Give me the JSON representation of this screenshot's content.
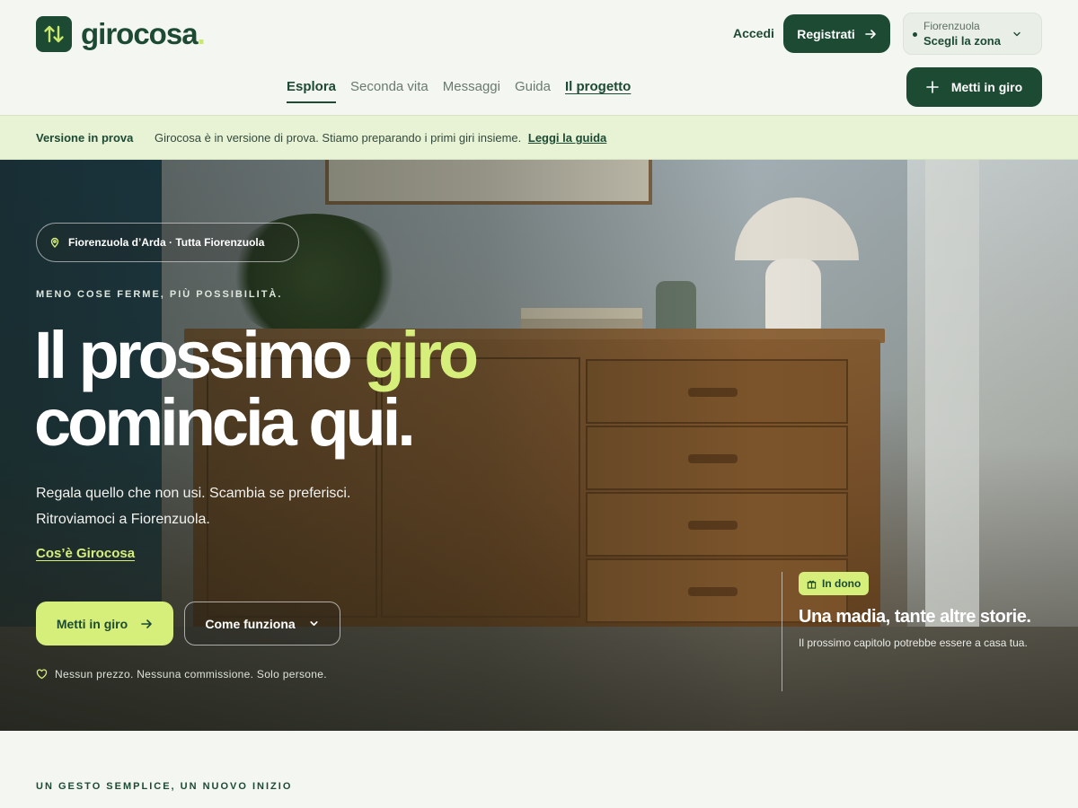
{
  "brand": {
    "name": "girocosa",
    "dot": "."
  },
  "header": {
    "login": "Accedi",
    "register": "Registrati",
    "zone_city": "Fiorenzuola",
    "zone_label": "Scegli la zona",
    "nav": [
      "Esplora",
      "Seconda vita",
      "Messaggi",
      "Guida",
      "Il progetto"
    ],
    "cta": "Metti in giro"
  },
  "banner": {
    "tag": "Versione in prova",
    "message": "Girocosa è in versione di prova. Stiamo preparando i primi giri insieme.",
    "link": "Leggi la guida"
  },
  "hero": {
    "location": "Fiorenzuola d’Arda · Tutta Fiorenzuola",
    "eyebrow": "MENO COSE FERME, PIÙ POSSIBILITÀ.",
    "title_a": "Il prossimo ",
    "title_hl": "giro",
    "title_b": "comincia qui.",
    "sub_1": "Regala quello che non usi. Scambia se preferisci.",
    "sub_2": "Ritroviamoci a Fiorenzuola.",
    "link": "Cos’è Girocosa",
    "primary": "Metti in giro",
    "secondary": "Come funziona",
    "tagline": "Nessun prezzo. Nessuna commissione. Solo persone."
  },
  "card": {
    "badge": "In dono",
    "title": "Una madia, tante altre storie.",
    "text": "Il prossimo capitolo potrebbe essere a casa tua."
  },
  "section": {
    "eyebrow": "UN GESTO SEMPLICE, UN NUOVO INIZIO"
  },
  "colors": {
    "brand": "#1d4a33",
    "accent": "#d5ef7a",
    "banner": "#e8f3d6"
  }
}
